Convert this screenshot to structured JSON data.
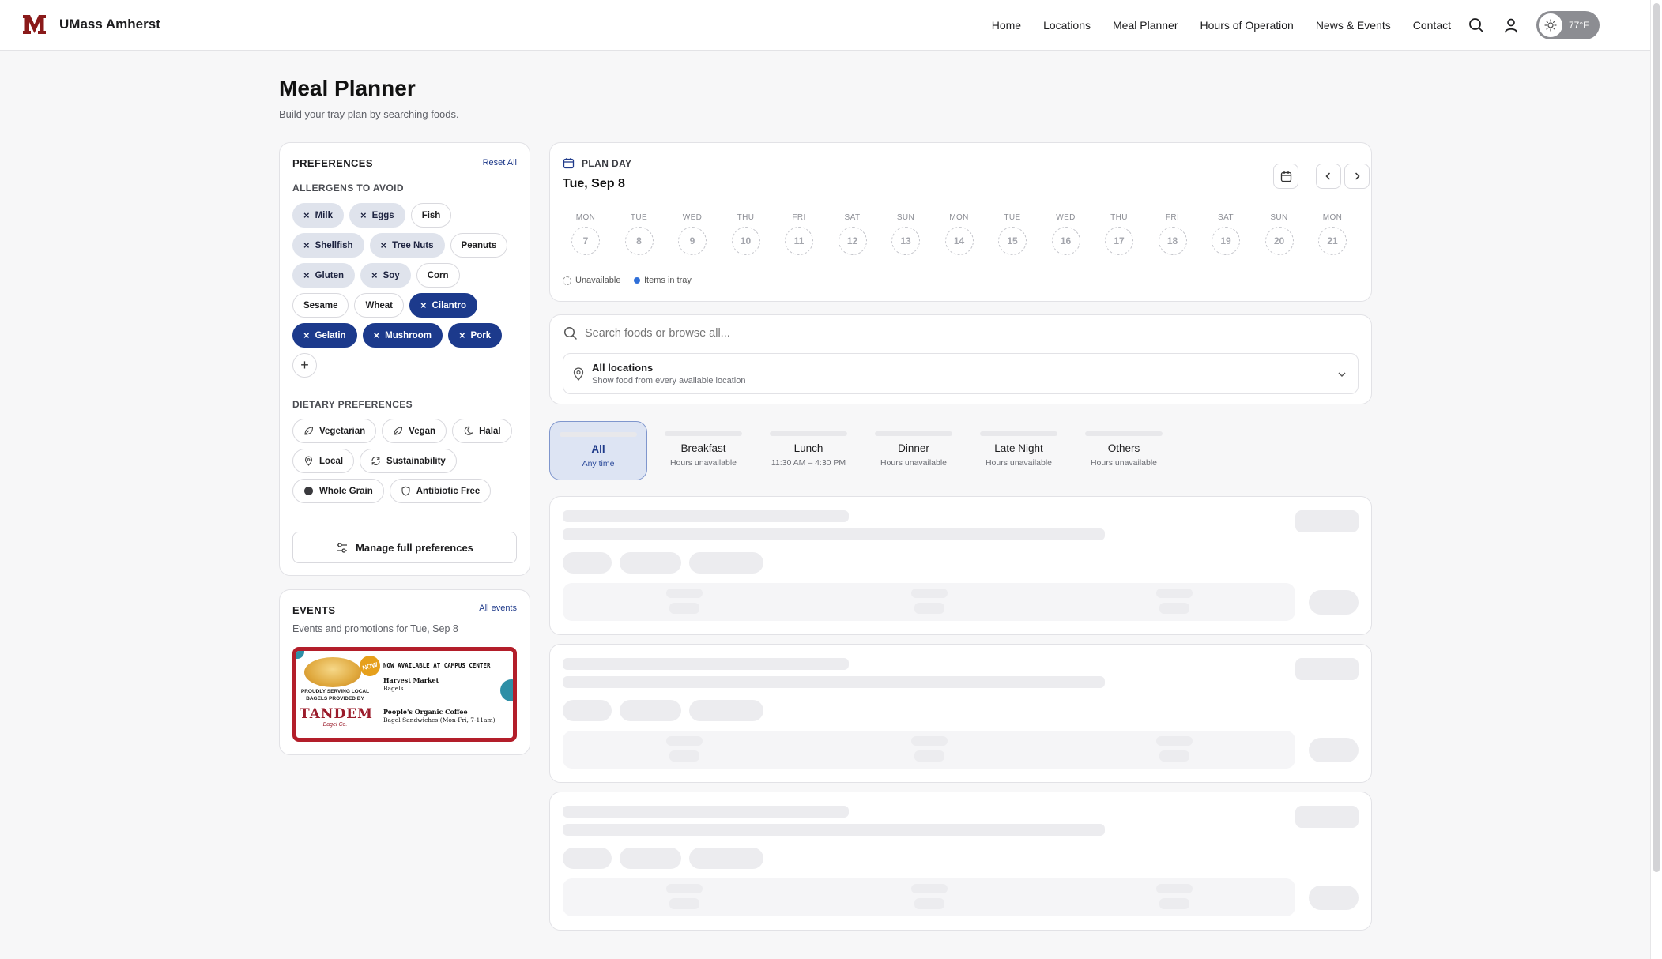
{
  "brand": {
    "name": "UMass Amherst",
    "logo_icon": "umass-m-logo",
    "color": "#8a1a1a"
  },
  "nav": {
    "links": [
      "Home",
      "Locations",
      "Meal Planner",
      "Hours of Operation",
      "News & Events",
      "Contact"
    ],
    "weather": {
      "temp": "77°F",
      "icon": "sun-icon"
    }
  },
  "page": {
    "title": "Meal Planner",
    "subtitle": "Build your tray plan by searching foods."
  },
  "preferences": {
    "heading": "PREFERENCES",
    "reset_label": "Reset All",
    "allergens_heading": "ALLERGENS TO AVOID",
    "allergens": [
      {
        "label": "Milk",
        "state": "grey"
      },
      {
        "label": "Eggs",
        "state": "grey"
      },
      {
        "label": "Fish",
        "state": "off"
      },
      {
        "label": "Shellfish",
        "state": "grey"
      },
      {
        "label": "Tree Nuts",
        "state": "grey"
      },
      {
        "label": "Peanuts",
        "state": "off"
      },
      {
        "label": "Gluten",
        "state": "grey"
      },
      {
        "label": "Soy",
        "state": "grey"
      },
      {
        "label": "Corn",
        "state": "off"
      },
      {
        "label": "Sesame",
        "state": "off"
      },
      {
        "label": "Wheat",
        "state": "off"
      },
      {
        "label": "Cilantro",
        "state": "blue"
      },
      {
        "label": "Gelatin",
        "state": "blue"
      },
      {
        "label": "Mushroom",
        "state": "blue"
      },
      {
        "label": "Pork",
        "state": "blue"
      }
    ],
    "add_label": "+",
    "dietary_heading": "DIETARY PREFERENCES",
    "dietary": [
      {
        "label": "Vegetarian",
        "icon": "leaf-icon"
      },
      {
        "label": "Vegan",
        "icon": "leaf-icon"
      },
      {
        "label": "Halal",
        "icon": "crescent-icon"
      },
      {
        "label": "Local",
        "icon": "location-pin-icon"
      },
      {
        "label": "Sustainability",
        "icon": "recycle-icon"
      },
      {
        "label": "Whole Grain",
        "icon": "grain-dot-icon"
      },
      {
        "label": "Antibiotic Free",
        "icon": "shield-icon"
      }
    ],
    "manage_label": "Manage full preferences"
  },
  "events": {
    "heading": "EVENTS",
    "all_label": "All events",
    "subtitle": "Events and promotions for Tue, Sep 8",
    "banner": {
      "headline": "NOW AVAILABLE AT CAMPUS CENTER",
      "badge": "NOW",
      "left_line1": "PROUDLY SERVING LOCAL",
      "left_line2": "BAGELS PROVIDED BY",
      "brand": "TANDEM",
      "brand_sub": "Bagel Co.",
      "item1_title": "Harvest Market",
      "item1_sub": "Bagels",
      "item2_title": "People's Organic Coffee",
      "item2_sub": "Bagel Sandwiches (Mon-Fri, 7-11am)"
    }
  },
  "plan": {
    "label": "PLAN DAY",
    "date": "Tue, Sep 8",
    "days": [
      {
        "name": "MON",
        "num": "7"
      },
      {
        "name": "TUE",
        "num": "8"
      },
      {
        "name": "WED",
        "num": "9"
      },
      {
        "name": "THU",
        "num": "10"
      },
      {
        "name": "FRI",
        "num": "11"
      },
      {
        "name": "SAT",
        "num": "12"
      },
      {
        "name": "SUN",
        "num": "13"
      },
      {
        "name": "MON",
        "num": "14"
      },
      {
        "name": "TUE",
        "num": "15"
      },
      {
        "name": "WED",
        "num": "16"
      },
      {
        "name": "THU",
        "num": "17"
      },
      {
        "name": "FRI",
        "num": "18"
      },
      {
        "name": "SAT",
        "num": "19"
      },
      {
        "name": "SUN",
        "num": "20"
      },
      {
        "name": "MON",
        "num": "21"
      }
    ],
    "legend_unavailable": "Unavailable",
    "legend_tray": "Items in tray",
    "tray_color": "#2f6fd8"
  },
  "search": {
    "placeholder": "Search foods or browse all...",
    "location_title": "All locations",
    "location_sub": "Show food from every available location"
  },
  "meals": [
    {
      "name": "All",
      "hours": "Any time"
    },
    {
      "name": "Breakfast",
      "hours": "Hours unavailable"
    },
    {
      "name": "Lunch",
      "hours": "11:30 AM – 4:30 PM"
    },
    {
      "name": "Dinner",
      "hours": "Hours unavailable"
    },
    {
      "name": "Late Night",
      "hours": "Hours unavailable"
    },
    {
      "name": "Others",
      "hours": "Hours unavailable"
    }
  ],
  "colors": {
    "accent": "#1c3a8c",
    "accent_light": "#dde4f3",
    "chip_grey": "#dfe3ec"
  }
}
